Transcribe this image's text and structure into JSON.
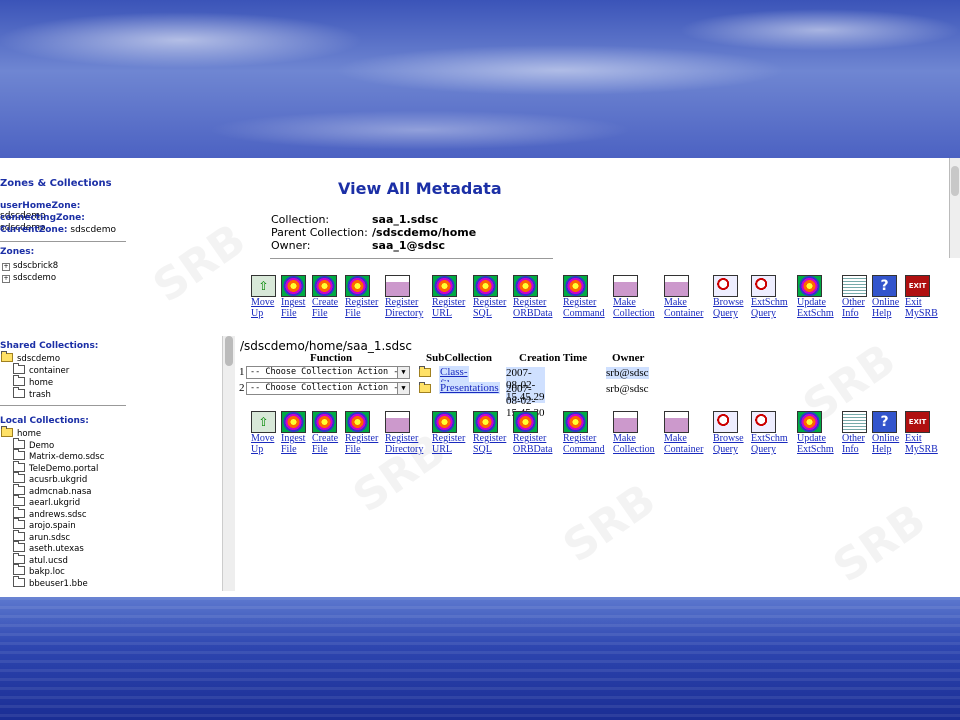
{
  "left": {
    "zones_header": "Zones & Collections",
    "userHomeZone_label": "userHomeZone:",
    "userHomeZone": "sdscdemo",
    "connectingZone_label": "connectingZone:",
    "connectingZone": "sdscdemo",
    "currentZone_label": "CurrentZone:",
    "currentZone": "sdscdemo",
    "zones_label": "Zones:",
    "zones": [
      "sdscbrick8",
      "sdscdemo"
    ],
    "shared_label": "Shared Collections:",
    "shared_root": "sdscdemo",
    "shared_items": [
      "container",
      "home",
      "trash"
    ],
    "local_label": "Local Collections:",
    "local_root": "home",
    "local_items": [
      "Demo",
      "Matrix-demo.sdsc",
      "TeleDemo.portal",
      "acusrb.ukgrid",
      "admcnab.nasa",
      "aearl.ukgrid",
      "andrews.sdsc",
      "arojo.spain",
      "arun.sdsc",
      "aseth.utexas",
      "atul.ucsd",
      "bakp.loc",
      "bbeuser1.bbe"
    ]
  },
  "main": {
    "title": "View All Metadata",
    "collection_label": "Collection:",
    "collection": "saa_1.sdsc",
    "parent_label": "Parent Collection:",
    "parent": "/sdscdemo/home",
    "owner_label": "Owner:",
    "owner": "saa_1@sdsc",
    "path": "/sdscdemo/home/saa_1.sdsc",
    "toolbar": [
      {
        "l1": "Move",
        "l2": "Up",
        "icon": "up"
      },
      {
        "l1": "Ingest",
        "l2": "File",
        "icon": "spiral"
      },
      {
        "l1": "Create",
        "l2": "File",
        "icon": "spiral"
      },
      {
        "l1": "Register",
        "l2": "File",
        "icon": "spiral"
      },
      {
        "l1": "Register",
        "l2": "Directory",
        "icon": "doc"
      },
      {
        "l1": "Register",
        "l2": "URL",
        "icon": "spiral"
      },
      {
        "l1": "Register",
        "l2": "SQL",
        "icon": "spiral"
      },
      {
        "l1": "Register",
        "l2": "ORBData",
        "icon": "spiral"
      },
      {
        "l1": "Register",
        "l2": "Command",
        "icon": "spiral"
      },
      {
        "l1": "Make",
        "l2": "Collection",
        "icon": "doc"
      },
      {
        "l1": "Make",
        "l2": "Container",
        "icon": "doc"
      },
      {
        "l1": "Browse",
        "l2": "Query",
        "icon": "search"
      },
      {
        "l1": "ExtSchm",
        "l2": "Query",
        "icon": "search"
      },
      {
        "l1": "Update",
        "l2": "ExtSchm",
        "icon": "spiral"
      },
      {
        "l1": "Other",
        "l2": "Info",
        "icon": "pad"
      },
      {
        "l1": "Online",
        "l2": "Help",
        "icon": "help"
      },
      {
        "l1": "Exit",
        "l2": "MySRB",
        "icon": "exit"
      }
    ],
    "table": {
      "headers": [
        "Function",
        "SubCollection",
        "Creation Time",
        "Owner"
      ],
      "rows": [
        {
          "num": "1",
          "action": "-- Choose Collection Action --",
          "subcollection": "Class-files",
          "time": "2007-08-02-15.45.29",
          "owner": "srb@sdsc"
        },
        {
          "num": "2",
          "action": "-- Choose Collection Action --",
          "subcollection": "Presentations",
          "time": "2007-08-02-15.45.30",
          "owner": "srb@sdsc"
        }
      ]
    },
    "exit_icon_text": "EXIT",
    "help_icon_text": "?",
    "up_icon_text": "⇧",
    "watermark": "SRB"
  }
}
